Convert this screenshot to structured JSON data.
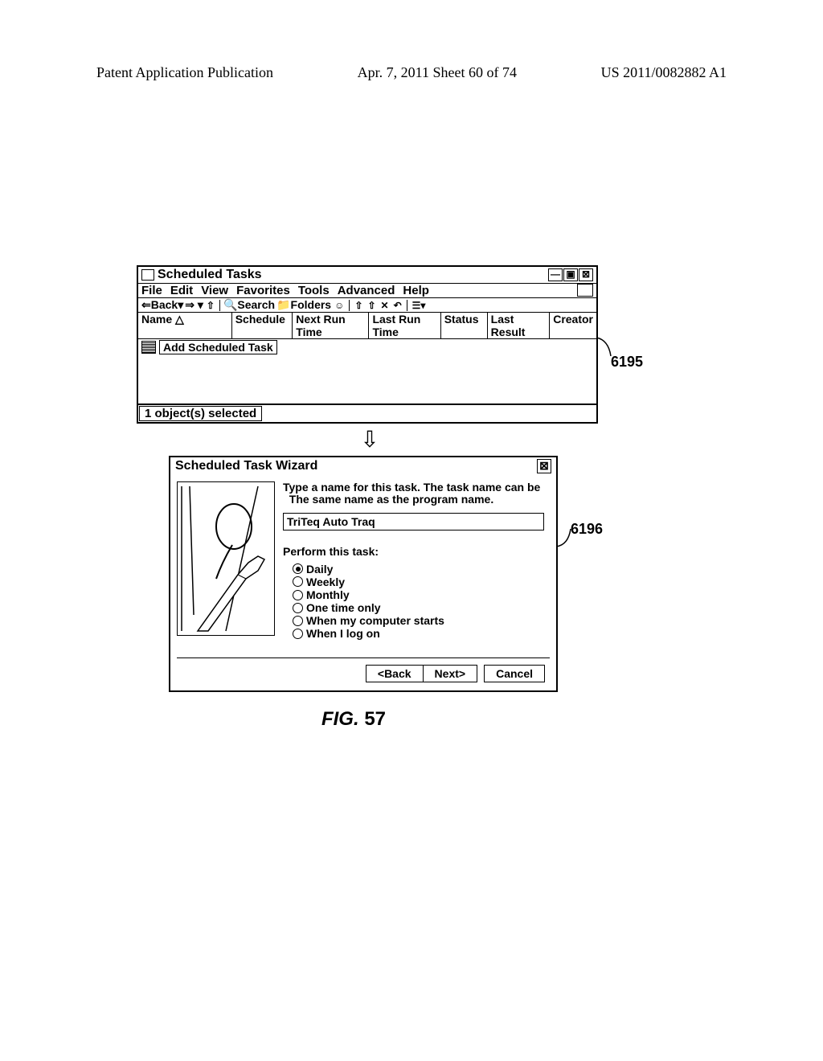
{
  "doc_header": {
    "left": "Patent Application Publication",
    "center": "Apr. 7, 2011  Sheet 60 of 74",
    "right": "US 2011/0082882 A1"
  },
  "callouts": {
    "upper": "6195",
    "lower": "6196"
  },
  "window": {
    "title": "Scheduled Tasks",
    "menu": [
      "File",
      "Edit",
      "View",
      "Favorites",
      "Tools",
      "Advanced",
      "Help"
    ],
    "toolbar": {
      "back": "Back",
      "search": "Search",
      "folders": "Folders"
    },
    "columns": [
      "Name",
      "Schedule",
      "Next Run Time",
      "Last Run Time",
      "Status",
      "Last Result",
      "Creator"
    ],
    "task_item": "Add Scheduled Task",
    "status": "1 object(s) selected"
  },
  "wizard": {
    "title": "Scheduled Task Wizard",
    "prompt1": "Type a name for this task. The task name can be",
    "prompt2": "The same name as the program name.",
    "input": "TriTeq Auto Traq",
    "perform": "Perform this task:",
    "options": [
      "Daily",
      "Weekly",
      "Monthly",
      "One time only",
      "When my computer starts",
      "When I log on"
    ],
    "selected": 0,
    "back": "<Back",
    "next": "Next>",
    "cancel": "Cancel"
  },
  "figure": {
    "label": "FIG.",
    "num": "57"
  }
}
